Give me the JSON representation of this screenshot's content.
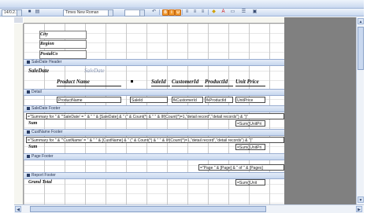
{
  "toolbar": {
    "font_size_value": "14/0.2.1",
    "font_name_value": "Times New Roman",
    "bold": "B",
    "italic": "I",
    "underline": "U"
  },
  "page_header_fields": [
    "City",
    "Region",
    "PostalCo"
  ],
  "bands": {
    "saledate_header": "SaleDate Header",
    "detail": "Detail",
    "saledate_footer": "SaleDate Footer",
    "custname_footer": "CustName Footer",
    "page_footer": "Page Footer",
    "report_footer": "Report Footer"
  },
  "saledate_header": {
    "label": "SaleDate",
    "field": "SaleDate",
    "col_product": "Product Name",
    "col_saleid": "SaleId",
    "col_customerid": "CustomerId",
    "col_productid": "ProductId",
    "col_unitprice": "Unit Price"
  },
  "detail": {
    "productname": "ProductName",
    "saleid": "SaleId",
    "customerid": "fkCustomerId",
    "productid": "fkProductId",
    "unitprice": "UnitPrice"
  },
  "saledate_footer": {
    "summary_expr": "=\"Summary for \" & \"'SaleDate' = \" & \" \" & [SaleDate] & \" (\" & Count(*) & \" \" & IIf(Count(*)=1,\"detail record\",\"detail records\") & \")\"",
    "sum_label": "Sum",
    "sum_expr": "=Sum([UnitPri"
  },
  "custname_footer": {
    "summary_expr": "=\"Summary for \" & \"'CustName' = \" & \" \" & [CustName] & \" (\" & Count(*) & \" \" & IIf(Count(*)=1,\"detail record\",\"detail records\") & \")\"",
    "sum_label": "Sum",
    "sum_expr": "=Sum([UnitPri"
  },
  "page_footer": {
    "page_expr": "=\"Page \" & [Page] & \" of \" & [Pages]"
  },
  "report_footer": {
    "grand_total_label": "Grand Total",
    "sum_expr": "=Sum([Unit"
  }
}
